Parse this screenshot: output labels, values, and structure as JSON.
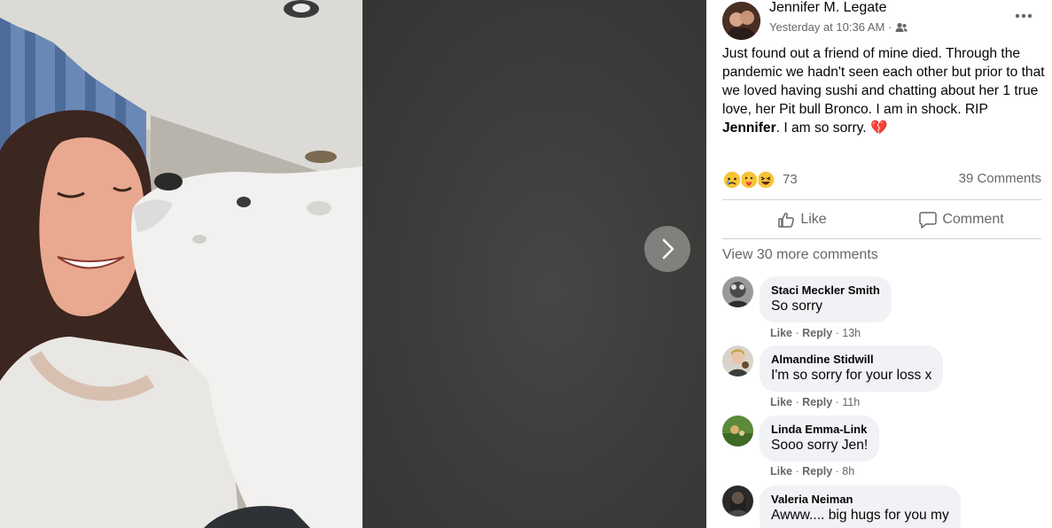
{
  "post": {
    "author": "Jennifer M. Legate",
    "time": "Yesterday at 10:36 AM · ",
    "body_1": "Just found out a friend of mine died. Through the pandemic we hadn't seen each other but prior to that we loved having sushi and chatting about her 1 true love, her Pit bull Bronco. I am in shock. RIP ",
    "body_bold": "Jennifer",
    "body_2": ". I am so sorry. ",
    "body_emoji": "💔",
    "reaction_count": "73",
    "comments_count": "39 Comments",
    "like_label": "Like",
    "comment_label": "Comment",
    "view_more": "View 30 more comments"
  },
  "comments": [
    {
      "name": "Staci Meckler Smith",
      "text": "So sorry",
      "like": "Like",
      "reply": "Reply",
      "time": "13h"
    },
    {
      "name": "Almandine Stidwill",
      "text": "I'm so sorry for your loss x",
      "like": "Like",
      "reply": "Reply",
      "time": "11h"
    },
    {
      "name": "Linda Emma-Link",
      "text": "Sooo sorry Jen!",
      "like": "Like",
      "reply": "Reply",
      "time": "8h"
    },
    {
      "name": "Valeria Neiman",
      "text": "Awww.... big hugs for you my"
    }
  ],
  "icons": {
    "next": "chevron-right-icon",
    "more": "more-horizontal-icon",
    "audience": "friends-icon",
    "like": "thumbs-up-icon",
    "comment": "speech-bubble-icon",
    "reactions": [
      "sad-reaction-icon",
      "care-reaction-icon",
      "haha-reaction-icon"
    ]
  },
  "colors": {
    "text_primary": "#050505",
    "text_secondary": "#65676b",
    "bubble": "#f0f2f5",
    "viewer_bg": "#3a3a38"
  }
}
